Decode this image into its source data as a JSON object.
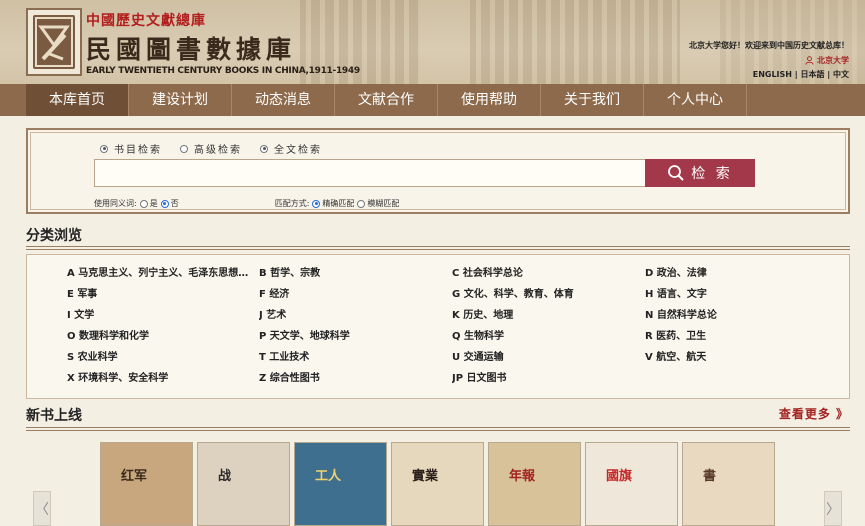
{
  "header": {
    "org_name": "中國歷史文獻總庫",
    "db_name": "民國圖書數據庫",
    "db_name_en": "EARLY TWENTIETH CENTURY BOOKS IN CHINA,1911-1949",
    "welcome": "北京大学您好！欢迎来到中国历史文献总库！",
    "user": "北京大学",
    "languages": [
      "ENGLISH",
      "日本語",
      "中文"
    ],
    "language_sep": " | "
  },
  "nav": {
    "items": [
      "本库首页",
      "建设计划",
      "动态消息",
      "文献合作",
      "使用帮助",
      "关于我们",
      "个人中心"
    ],
    "active_index": 0
  },
  "search": {
    "modes": [
      {
        "label": "书目检索",
        "selected": true
      },
      {
        "label": "高级检索",
        "selected": false
      },
      {
        "label": "全文检索",
        "selected": true
      }
    ],
    "input_value": "",
    "button_label": "检 索",
    "synonym_label": "使用同义词:",
    "synonym_options": [
      {
        "label": "是",
        "selected": false
      },
      {
        "label": "否",
        "selected": true
      }
    ],
    "match_label": "匹配方式:",
    "match_options": [
      {
        "label": "精确匹配",
        "selected": true
      },
      {
        "label": "模糊匹配",
        "selected": false
      }
    ]
  },
  "categories": {
    "title": "分类浏览",
    "items": [
      "A 马克思主义、列宁主义、毛泽东思想、邓小平理论",
      "B 哲学、宗教",
      "C 社会科学总论",
      "D 政治、法律",
      "E 军事",
      "F 经济",
      "G 文化、科学、教育、体育",
      "H 语言、文字",
      "I 文学",
      "J 艺术",
      "K 历史、地理",
      "N 自然科学总论",
      "O 数理科学和化学",
      "P 天文学、地球科学",
      "Q 生物科学",
      "R 医药、卫生",
      "S 农业科学",
      "T 工业技术",
      "U 交通运输",
      "V 航空、航天",
      "X 环境科学、安全科学",
      "Z 综合性图书",
      "JP 日文图书"
    ]
  },
  "new_books": {
    "title": "新书上线",
    "more_label": "查看更多 》",
    "prev_arrow": "〈",
    "next_arrow": "〉",
    "books": [
      {
        "cover_text": "红军",
        "bg": "#c9a77e",
        "fg": "#3a2a1c"
      },
      {
        "cover_text": "战",
        "bg": "#ddd2bf",
        "fg": "#2a2a2a"
      },
      {
        "cover_text": "工人",
        "bg": "#3f6f8f",
        "fg": "#f2d36b"
      },
      {
        "cover_text": "實業",
        "bg": "#e6d8bc",
        "fg": "#2a1f1a"
      },
      {
        "cover_text": "年報",
        "bg": "#d8c29a",
        "fg": "#a32222"
      },
      {
        "cover_text": "國旗",
        "bg": "#efe7da",
        "fg": "#c62828"
      },
      {
        "cover_text": "書",
        "bg": "#e8d9c0",
        "fg": "#5a3a2a"
      }
    ]
  },
  "colors": {
    "nav_bg": "#8e6a4c",
    "nav_active": "#6f4f36",
    "accent_red": "#a3384a",
    "link_red": "#a32222"
  }
}
